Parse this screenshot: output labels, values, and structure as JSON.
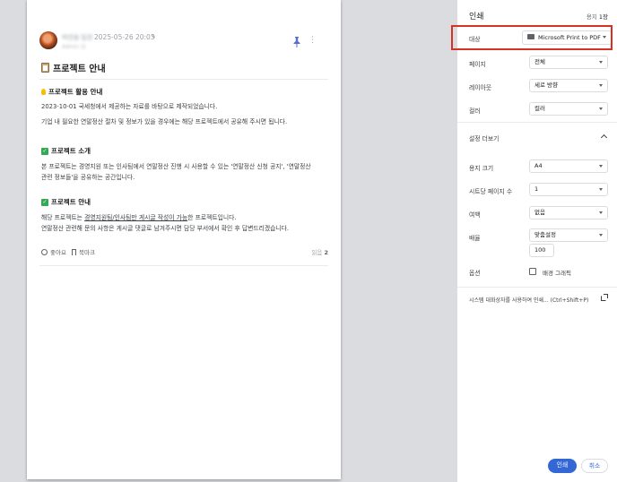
{
  "preview": {
    "post": {
      "author": "박한용 팀장",
      "sub_author": "Admin 님",
      "date": "2025-05-26 20:03",
      "edit_mark": "✎",
      "title": "프로젝트 안내",
      "sections": [
        {
          "heading": "프로젝트 활용 안내",
          "lines": [
            "2023-10-01 국세청에서 제공하는 자료를 바탕으로 제작되었습니다.",
            "기업 내 필요한 연말정산 절차 및 정보가 있을 경우에는 해당 프로젝트에서 공유해 주시면 됩니다."
          ]
        },
        {
          "heading": "프로젝트 소개",
          "lines": [
            "본 프로젝트는 경영지원 또는 인사팀에서 연말정산 진행 시 사용할 수 있는 '연말정산 신청 공지', '연말정산",
            "관련 정보들'을 공유하는 공간입니다."
          ]
        },
        {
          "heading": "프로젝트 안내",
          "line1_prefix": "해당 프로젝트는 ",
          "line1_underlined": "경영지원팀/인사팀만 게시글 작성이 가능",
          "line1_suffix": "한 프로젝트입니다.",
          "line2": "연말정산 관련해 문의 사항은 게시글 댓글로 남겨주시면 담당 부서에서 확인 후 답변드리겠습니다."
        }
      ],
      "like_label": "좋아요",
      "bookmark_label": "북마크",
      "views_label": "읽음",
      "views_count": "2"
    }
  },
  "print_panel": {
    "title": "인쇄",
    "sheet_prefix": "용지 ",
    "sheet_count": "1장",
    "destination_label": "대상",
    "destination_value": "Microsoft Print to PDF",
    "pages_label": "페이지",
    "pages_value": "전체",
    "layout_label": "레이아웃",
    "layout_value": "세로 방향",
    "color_label": "컬러",
    "color_value": "컬러",
    "more_settings_label": "설정 더보기",
    "paper_size_label": "용지 크기",
    "paper_size_value": "A4",
    "pages_per_sheet_label": "시트당 페이지 수",
    "pages_per_sheet_value": "1",
    "margins_label": "여백",
    "margins_value": "없음",
    "scale_label": "배율",
    "scale_value": "맞춤설정",
    "scale_input": "100",
    "options_label": "옵션",
    "background_graphics_label": "배경 그래픽",
    "system_dialog_label": "시스템 대화상자를 사용하여 인쇄... (Ctrl+Shift+P)",
    "print_button": "인쇄",
    "cancel_button": "취소"
  },
  "colors": {
    "accent": "#3367d6",
    "highlight": "#d93025",
    "pin": "#5b6bd6"
  }
}
